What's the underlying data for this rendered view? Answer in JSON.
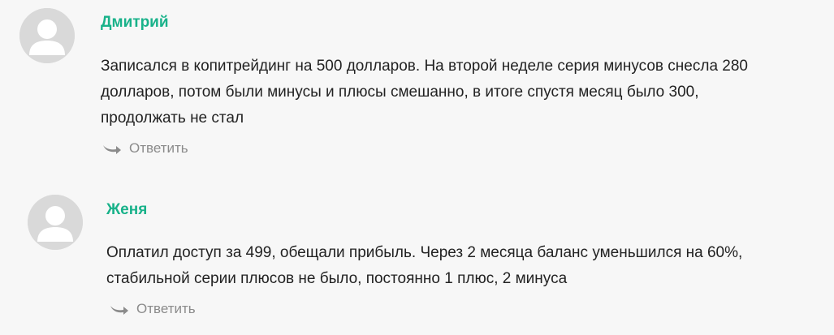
{
  "comments": [
    {
      "author": "Дмитрий",
      "text_lines": [
        "Записался в копитрейдинг на 500 долларов. На второй неделе серия минусов снесла 280",
        "долларов, потом были минусы и плюсы смешанно, в итоге спустя месяц было 300,",
        "продолжать не стал"
      ],
      "reply_label": "Ответить",
      "avatar_icon": "user-avatar-icon",
      "reply_icon": "reply-arrow-icon"
    },
    {
      "author": "Женя",
      "text_lines": [
        "Оплатил доступ за 499, обещали прибыль. Через 2 месяца баланс уменьшился на 60%,",
        "стабильной серии плюсов не было, постоянно 1 плюс, 2 минуса"
      ],
      "reply_label": "Ответить",
      "avatar_icon": "user-avatar-icon",
      "reply_icon": "reply-arrow-icon"
    }
  ],
  "colors": {
    "background": "#f7f7f7",
    "author": "#19b28a",
    "text": "#222222",
    "reply": "#8b8b8b",
    "avatar_bg": "#d9d9d9",
    "avatar_fg": "#ffffff"
  }
}
